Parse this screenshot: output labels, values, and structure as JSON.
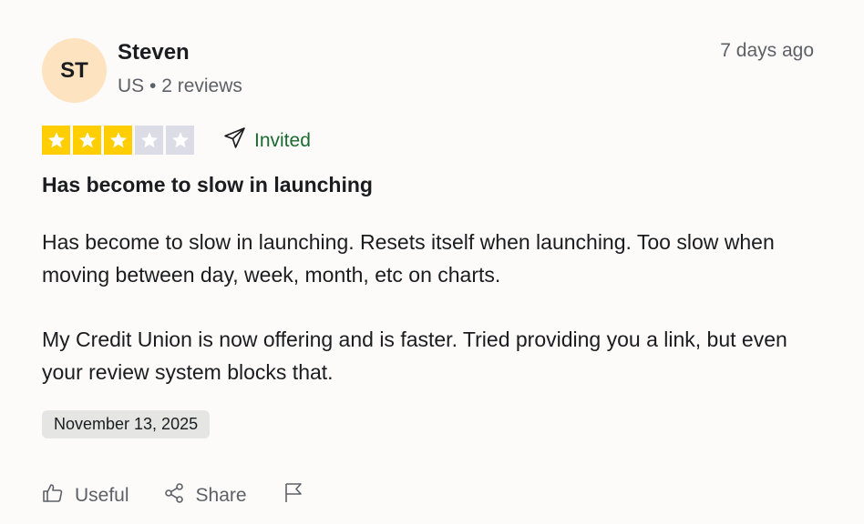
{
  "reviewer": {
    "initials": "ST",
    "name": "Steven",
    "meta": "US • 2 reviews"
  },
  "date_ago": "7 days ago",
  "rating": {
    "value": 3,
    "max": 5
  },
  "invited_label": "Invited",
  "review": {
    "title": "Has become to slow in launching",
    "paragraphs": [
      "Has become to slow in launching. Resets itself when launching. Too slow when moving between day, week, month, etc on charts.",
      "My Credit Union is now offering and is faster. Tried providing you a link, but even your review system blocks that."
    ]
  },
  "experience_date": "November 13, 2025",
  "actions": {
    "useful_label": "Useful",
    "share_label": "Share"
  },
  "colors": {
    "avatar_bg": "#fde3bf",
    "star_filled": "#ffce00",
    "star_empty": "#dcdce6",
    "invited": "#1a6b2f"
  },
  "icons": [
    "paper-plane-icon",
    "thumbs-up-icon",
    "share-icon",
    "flag-icon",
    "star-icon"
  ]
}
